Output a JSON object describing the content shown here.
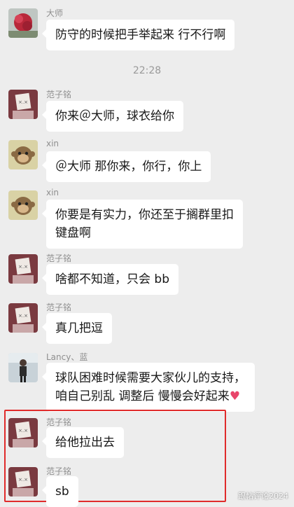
{
  "time_divider": "22:28",
  "messages": [
    {
      "sender": "大师",
      "text": "防守的时候把手举起来 行不行啊",
      "avatar": "red-leaf-avatar"
    },
    {
      "sender": "范子铭",
      "text": "你来＠大师，球衣给你",
      "avatar": "paper-face-avatar"
    },
    {
      "sender": "xin",
      "text": "＠大师 那你来，你行，你上",
      "avatar": "monkey-avatar"
    },
    {
      "sender": "xin",
      "line1": "你要是有实力，你还至于搁群里扣",
      "line2": "键盘啊",
      "avatar": "monkey-avatar"
    },
    {
      "sender": "范子铭",
      "text": "啥都不知道，只会 bb",
      "avatar": "paper-face-avatar"
    },
    {
      "sender": "范子铭",
      "text": "真几把逗",
      "avatar": "paper-face-avatar"
    },
    {
      "sender": "Lancy、蓝",
      "line1": "球队困难时候需要大家伙儿的支持，",
      "line2": "咱自己别乱 调整后 慢慢会好起来",
      "heart": "♥",
      "avatar": "person-avatar"
    },
    {
      "sender": "范子铭",
      "text": "给他拉出去",
      "avatar": "paper-face-avatar"
    },
    {
      "sender": "范子铭",
      "text": "sb",
      "avatar": "paper-face-avatar"
    }
  ],
  "watermark": "跟帖评论2024",
  "colors": {
    "background": "#ededed",
    "bubble": "#ffffff",
    "highlight": "#e02b2b"
  }
}
